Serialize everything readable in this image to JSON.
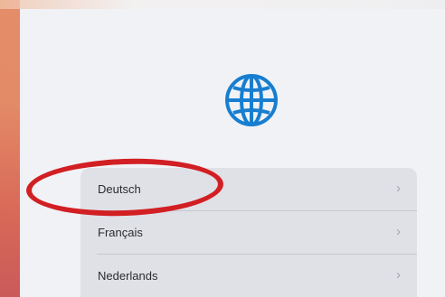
{
  "setup": {
    "languages": [
      {
        "label": "Deutsch"
      },
      {
        "label": "Français"
      },
      {
        "label": "Nederlands"
      }
    ],
    "icon": "globe-icon",
    "chevron_icon": "chevron-right-icon"
  },
  "colors": {
    "background": "#f1f2f6",
    "list_background": "#e0e1e7",
    "text": "#2b2b30",
    "accent": "#177ed0",
    "annotation": "#d21f23"
  }
}
